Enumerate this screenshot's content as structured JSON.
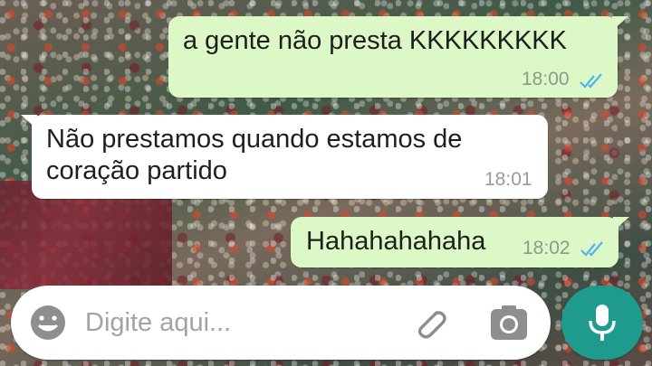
{
  "messages": [
    {
      "direction": "outgoing",
      "text": "a gente não presta KKKKKKKKK",
      "time": "18:00",
      "status": "read"
    },
    {
      "direction": "incoming",
      "text": "Não prestamos quando estamos de coração partido",
      "time": "18:01"
    },
    {
      "direction": "outgoing",
      "text": "Hahahahahaha",
      "time": "18:02",
      "status": "read"
    }
  ],
  "composer": {
    "placeholder": "Digite aqui...",
    "emoji_icon": "smiley-icon",
    "attach_icon": "paperclip-icon",
    "camera_icon": "camera-icon",
    "send_icon": "microphone-icon"
  },
  "colors": {
    "outgoing_bubble": "#dcf8c6",
    "incoming_bubble": "#ffffff",
    "read_ticks": "#4fb6ec",
    "mic_button": "#1f9b8e"
  }
}
